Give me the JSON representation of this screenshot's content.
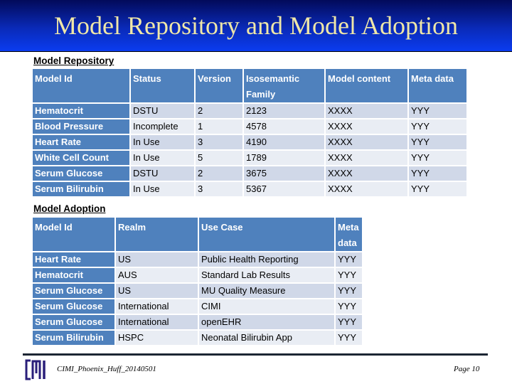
{
  "title": "Model Repository and Model Adoption",
  "repository": {
    "label": "Model Repository",
    "headers": [
      "Model Id",
      "Status",
      "Version",
      "Isosemantic Family",
      "Model content",
      "Meta data"
    ],
    "rows": [
      [
        "Hematocrit",
        "DSTU",
        "2",
        "2123",
        "XXXX",
        "YYY"
      ],
      [
        "Blood Pressure",
        "Incomplete",
        "1",
        "4578",
        "XXXX",
        "YYY"
      ],
      [
        "Heart Rate",
        "In Use",
        "3",
        "4190",
        "XXXX",
        "YYY"
      ],
      [
        "White Cell Count",
        "In Use",
        "5",
        "1789",
        "XXXX",
        "YYY"
      ],
      [
        "Serum Glucose",
        "DSTU",
        "2",
        "3675",
        "XXXX",
        "YYY"
      ],
      [
        "Serum Bilirubin",
        "In Use",
        "3",
        "5367",
        "XXXX",
        "YYY"
      ]
    ]
  },
  "adoption": {
    "label": "Model Adoption",
    "headers": [
      "Model Id",
      "Realm",
      "Use Case",
      "Meta data"
    ],
    "rows": [
      [
        "Heart Rate",
        "US",
        "Public Health Reporting",
        "YYY"
      ],
      [
        "Hematocrit",
        "AUS",
        "Standard Lab Results",
        "YYY"
      ],
      [
        "Serum Glucose",
        "US",
        "MU Quality Measure",
        "YYY"
      ],
      [
        "Serum Glucose",
        "International",
        "CIMI",
        "YYY"
      ],
      [
        "Serum Glucose",
        "International",
        "openEHR",
        "YYY"
      ],
      [
        "Serum Bilirubin",
        "HSPC",
        "Neonatal Bilirubin App",
        "YYY"
      ]
    ]
  },
  "footer": {
    "logo_text": "CIMI",
    "document_id": "CIMI_Phoenix_Huff_20140501",
    "page": "Page 10"
  },
  "colors": {
    "header_fill": "#4f81bd",
    "row_odd": "#d0d8e8",
    "row_even": "#e9edf4",
    "title_text": "#efe7a8"
  }
}
